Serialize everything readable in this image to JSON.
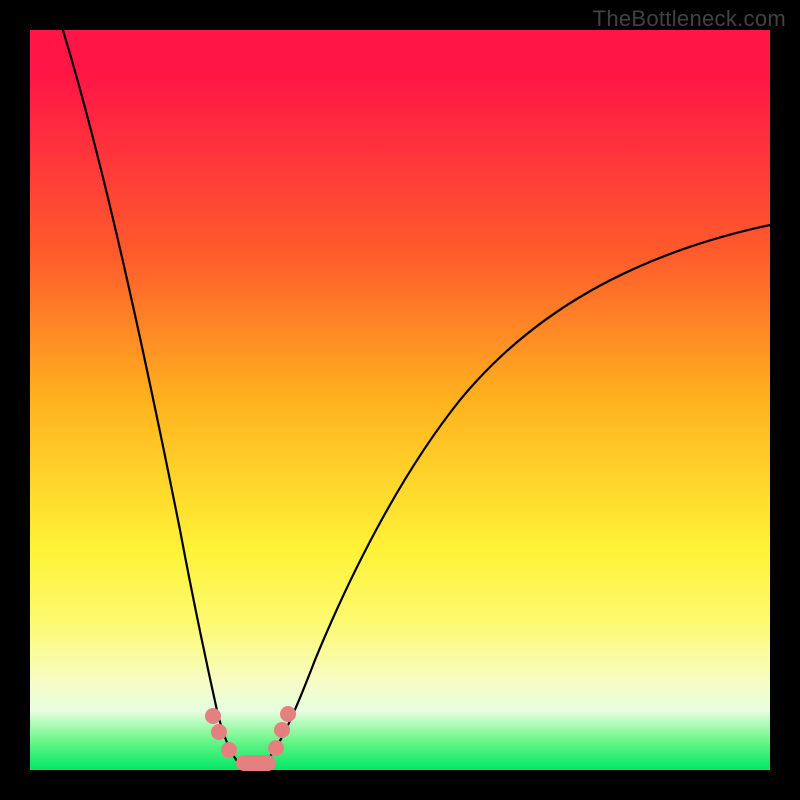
{
  "watermark": "TheBottleneck.com",
  "chart_data": {
    "type": "line",
    "title": "",
    "xlabel": "",
    "ylabel": "",
    "xlim": [
      0,
      100
    ],
    "ylim": [
      0,
      100
    ],
    "grid": false,
    "legend": false,
    "series": [
      {
        "name": "left-curve",
        "x": [
          2,
          6,
          10,
          14,
          18,
          20,
          22,
          23.5,
          25,
          26,
          27,
          28,
          29
        ],
        "y": [
          100,
          80,
          60,
          40,
          20,
          12,
          7,
          4,
          2,
          1,
          0.5,
          0.2,
          0
        ]
      },
      {
        "name": "right-curve",
        "x": [
          30,
          32,
          34,
          36,
          40,
          45,
          50,
          60,
          70,
          80,
          90,
          100
        ],
        "y": [
          0,
          1,
          3,
          6,
          12,
          20,
          28,
          42,
          53,
          61,
          67,
          72
        ]
      },
      {
        "name": "floor",
        "x": [
          26,
          27,
          28,
          29,
          30,
          31,
          32,
          33,
          34
        ],
        "y": [
          0,
          0,
          0,
          0,
          0,
          0,
          0,
          0,
          0
        ]
      }
    ],
    "markers": [
      {
        "name": "left-marker-upper",
        "x": 23.5,
        "y": 5
      },
      {
        "name": "left-marker-lower",
        "x": 24.3,
        "y": 3
      },
      {
        "name": "right-marker-upper",
        "x": 34.0,
        "y": 5
      },
      {
        "name": "right-marker-lower",
        "x": 33.2,
        "y": 3
      },
      {
        "name": "floor-marker-a",
        "x": 27,
        "y": 0
      },
      {
        "name": "floor-marker-b",
        "x": 29,
        "y": 0
      },
      {
        "name": "floor-marker-c",
        "x": 31,
        "y": 0
      },
      {
        "name": "floor-marker-d",
        "x": 33,
        "y": 0
      }
    ],
    "colors": {
      "gradient_top": "#ff1647",
      "gradient_bottom": "#00e765",
      "curve": "#000000",
      "marker": "#e58080",
      "frame": "#000000"
    }
  }
}
